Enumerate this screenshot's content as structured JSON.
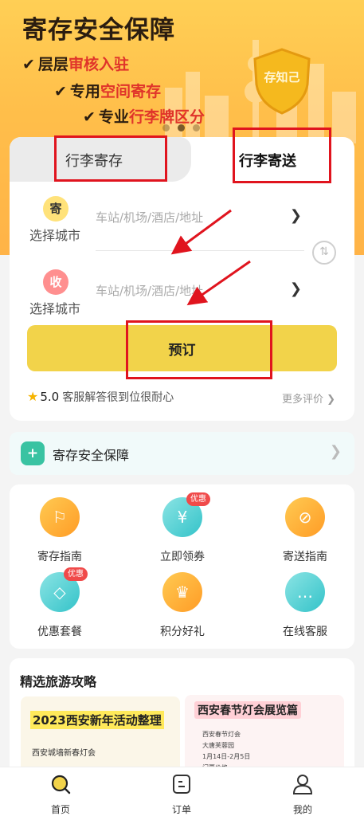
{
  "hero": {
    "title": "寄存安全保障",
    "line1_prefix": "层层",
    "line1_highlight": "审核入驻",
    "line2_prefix": "专用",
    "line2_highlight": "空间寄存",
    "line3_prefix": "专业",
    "line3_highlight": "行李牌区分",
    "badge_text": "存知己"
  },
  "tabs": {
    "left": "行李寄存",
    "right": "行李寄送"
  },
  "form": {
    "send_badge": "寄",
    "recv_badge": "收",
    "city_label": "选择城市",
    "addr_placeholder": "车站/机场/酒店/地址",
    "book_button": "预订"
  },
  "rating": {
    "score": "5.0",
    "comment": "客服解答很到位很耐心",
    "more": "更多评价"
  },
  "secure": {
    "label": "寄存安全保障"
  },
  "services": [
    {
      "label": "寄存指南",
      "icon": "signpost-icon"
    },
    {
      "label": "立即领券",
      "icon": "coupon-icon",
      "tag": "优惠"
    },
    {
      "label": "寄送指南",
      "icon": "compass-icon"
    },
    {
      "label": "优惠套餐",
      "icon": "price-tag-icon",
      "tag": "优惠"
    },
    {
      "label": "积分好礼",
      "icon": "crown-icon"
    },
    {
      "label": "在线客服",
      "icon": "chat-icon"
    }
  ],
  "guide": {
    "title": "精选旅游攻略",
    "card1_title": "2023西安新年活动整理",
    "card1_sub": "西安城墙新春灯会",
    "card2_title": "西安春节灯会展览篇",
    "card2_lines": [
      "西安春节灯会",
      "大唐芙蓉园",
      "1月14日-2月5日",
      "门票价格"
    ]
  },
  "nav": {
    "home": "首页",
    "orders": "订单",
    "mine": "我的"
  },
  "colors": {
    "accent_yellow": "#f2d34a",
    "hero_orange": "#ffbe4a",
    "annotation_red": "#e0141e"
  }
}
